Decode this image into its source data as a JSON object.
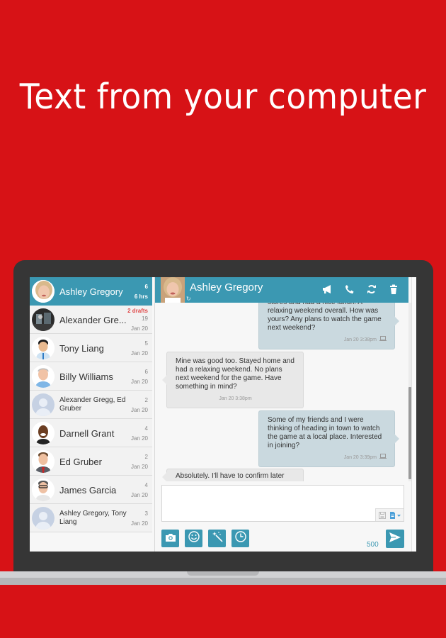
{
  "headline": "Text from your computer",
  "colors": {
    "background": "#d71216",
    "accent": "#3b98b2",
    "drafts": "#e04b4b",
    "outgoing_bubble": "#cad9df",
    "incoming_bubble": "#e8e8e8"
  },
  "sidebar": {
    "conversations": [
      {
        "name": "Ashley Gregory",
        "count": "6",
        "time": "6 hrs",
        "active": true,
        "avatar": "photo"
      },
      {
        "name": "Alexander Gre...",
        "drafts": "2 drafts",
        "count": "19",
        "time": "Jan 20",
        "avatar": "photo"
      },
      {
        "name": "Tony Liang",
        "count": "5",
        "time": "Jan 20",
        "avatar": "photo"
      },
      {
        "name": "Billy Williams",
        "count": "6",
        "time": "Jan 20",
        "avatar": "photo"
      },
      {
        "name": "Alexander Gregg, Ed Gruber",
        "count": "2",
        "time": "Jan 20",
        "avatar": "placeholder"
      },
      {
        "name": "Darnell Grant",
        "count": "4",
        "time": "Jan 20",
        "avatar": "photo"
      },
      {
        "name": "Ed Gruber",
        "count": "2",
        "time": "Jan 20",
        "avatar": "photo"
      },
      {
        "name": "James Garcia",
        "count": "4",
        "time": "Jan 20",
        "avatar": "photo"
      },
      {
        "name": "Ashley Gregory, Tony Liang",
        "count": "3",
        "time": "Jan 20",
        "avatar": "placeholder"
      }
    ]
  },
  "chat": {
    "contact_name": "Ashley Gregory",
    "header_icons": [
      "megaphone-icon",
      "phone-icon",
      "refresh-icon",
      "trash-icon"
    ],
    "messages": [
      {
        "direction": "out",
        "text": "stores and had a nice lunch. A relaxing weekend overall. How was yours? Any plans to watch the game next weekend?",
        "time": "Jan 20 3:38pm",
        "device": "laptop"
      },
      {
        "direction": "in",
        "text": "Mine was good too.  Stayed home and had a relaxing weekend.  No plans next weekend for the game.  Have something in mind?",
        "time": "Jan 20 3:38pm"
      },
      {
        "direction": "out",
        "text": "Some of my friends and I were thinking of heading in town to watch the game at a local place. Interested in joining?",
        "time": "Jan 20 3:39pm",
        "device": "laptop"
      },
      {
        "direction": "in",
        "text": "Absolutely.  I'll have to confirm later",
        "time": ""
      }
    ],
    "compose": {
      "value": "",
      "placeholder": "",
      "char_remaining": "500"
    },
    "toolbar": [
      "camera-icon",
      "emoji-icon",
      "magic-wand-icon",
      "clock-icon"
    ]
  }
}
